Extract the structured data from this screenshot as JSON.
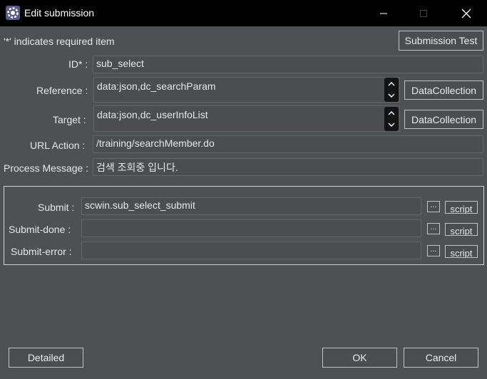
{
  "window": {
    "title": "Edit submission"
  },
  "required_note": "'*' indicates required item",
  "submission_test_label": "Submission Test",
  "fields": {
    "id": {
      "label": "ID* :",
      "value": "sub_select"
    },
    "reference": {
      "label": "Reference :",
      "value": "data:json,dc_searchParam",
      "button": "DataCollection"
    },
    "target": {
      "label": "Target :",
      "value": "data:json,dc_userInfoList",
      "button": "DataCollection"
    },
    "url_action": {
      "label": "URL Action :",
      "value": "/training/searchMember.do"
    },
    "process_message": {
      "label": "Process Message :",
      "value": "검색 조회중 입니다."
    }
  },
  "submit_group": {
    "submit": {
      "label": "Submit :",
      "value": "scwin.sub_select_submit",
      "ellipsis": "...",
      "script": "script"
    },
    "submit_done": {
      "label": "Submit-done :",
      "value": "",
      "ellipsis": "...",
      "script": "script"
    },
    "submit_error": {
      "label": "Submit-error :",
      "value": "",
      "ellipsis": "...",
      "script": "script"
    }
  },
  "footer": {
    "detailed_label": "Detailed",
    "ok_label": "OK",
    "cancel_label": "Cancel"
  }
}
